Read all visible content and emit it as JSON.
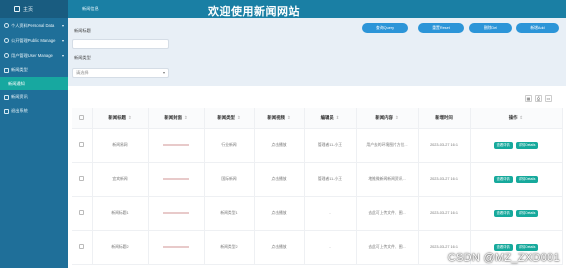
{
  "sidebar": {
    "home": "主页",
    "menus": [
      {
        "label": "个人资料Personal Data"
      },
      {
        "label": "公开管理Public Manage"
      },
      {
        "label": "用户管理User Manage"
      }
    ],
    "section": "新闻类型",
    "active_sub": "新闻通知",
    "items": [
      {
        "label": "新闻资讯"
      },
      {
        "label": "退出系统"
      }
    ]
  },
  "header": {
    "breadcrumb": "新闻信息",
    "title": "欢迎使用新闻网站"
  },
  "search": {
    "title_label": "新闻标题",
    "title_value": "",
    "type_label": "新闻类型",
    "type_value": "请选择",
    "buttons": [
      "查询Query",
      "重置Reset",
      "删除Del",
      "新增Add"
    ]
  },
  "table": {
    "headers": [
      "",
      "新闻标题",
      "新闻封面",
      "新闻类型",
      "新闻视频",
      "编辑员",
      "新闻内容",
      "新增时间",
      "操作"
    ],
    "rows": [
      [
        "新闻易网",
        "",
        "行业新闻",
        "点击播放",
        "管理者11-小王",
        "用户去的环境图片方位...",
        "2023-03-27 16:1",
        "查看详情",
        "详情Details"
      ],
      [
        "宜宾新闻",
        "",
        "国际新闻",
        "点击播放",
        "管理者11-小王",
        "地推微新闻新闻资讯...",
        "2023-03-27 16:1",
        "查看详情",
        "详情Details"
      ],
      [
        "新闻标题1",
        "",
        "新闻类型1",
        "点击播放",
        "-",
        "去此可上传文件、图...",
        "2023-03-27 16:1",
        "查看详情",
        "详情Details"
      ],
      [
        "新闻标题2",
        "",
        "新闻类型2",
        "点击播放",
        "-",
        "去此可上传文件、图...",
        "2023-03-27 16:1",
        "查看详情",
        "详情Details"
      ]
    ]
  },
  "watermark": "CSDN @MZ_ZXD001",
  "colors": {
    "sidebar": "#1f6f99",
    "header": "#1a7fa4",
    "accent": "#2c95d8",
    "action": "#16a99c"
  }
}
